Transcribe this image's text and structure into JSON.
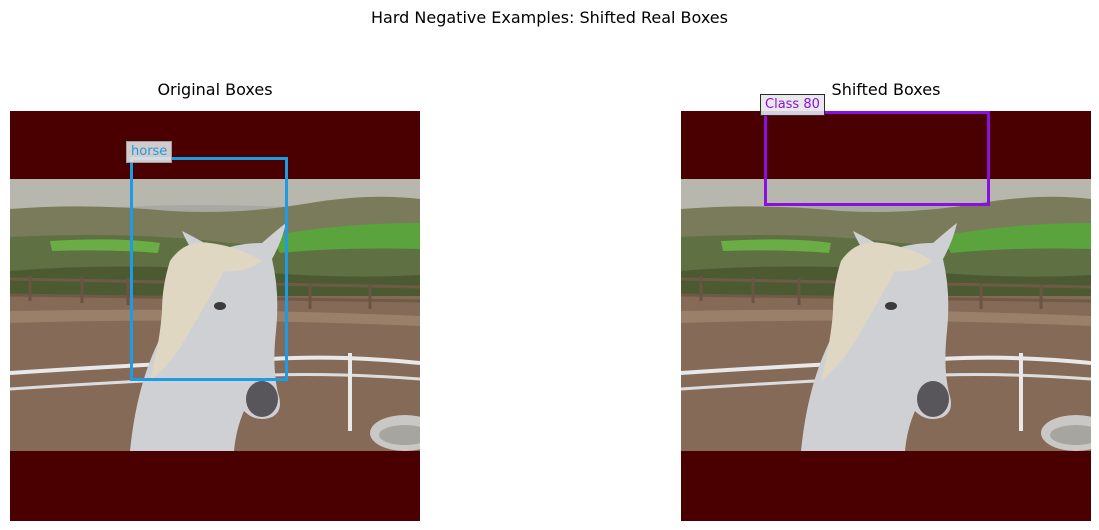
{
  "figure": {
    "suptitle": "Hard Negative Examples: Shifted Real Boxes"
  },
  "panels": [
    {
      "title": "Original Boxes",
      "label": "horse",
      "box_color": "#1e9be6"
    },
    {
      "title": "Shifted Boxes",
      "label": "Class 80",
      "box_color": "#8b10e0"
    }
  ],
  "colors": {
    "padding": "#4a0000",
    "sky": "#a9a9a2",
    "hillside": "#7d7b5d",
    "grass": "#58a23c",
    "ground": "#826854",
    "horse": "#cfd0d2",
    "mane": "#ded6c2",
    "fence": "#6f5a47",
    "rail": "#e7e8ea"
  }
}
